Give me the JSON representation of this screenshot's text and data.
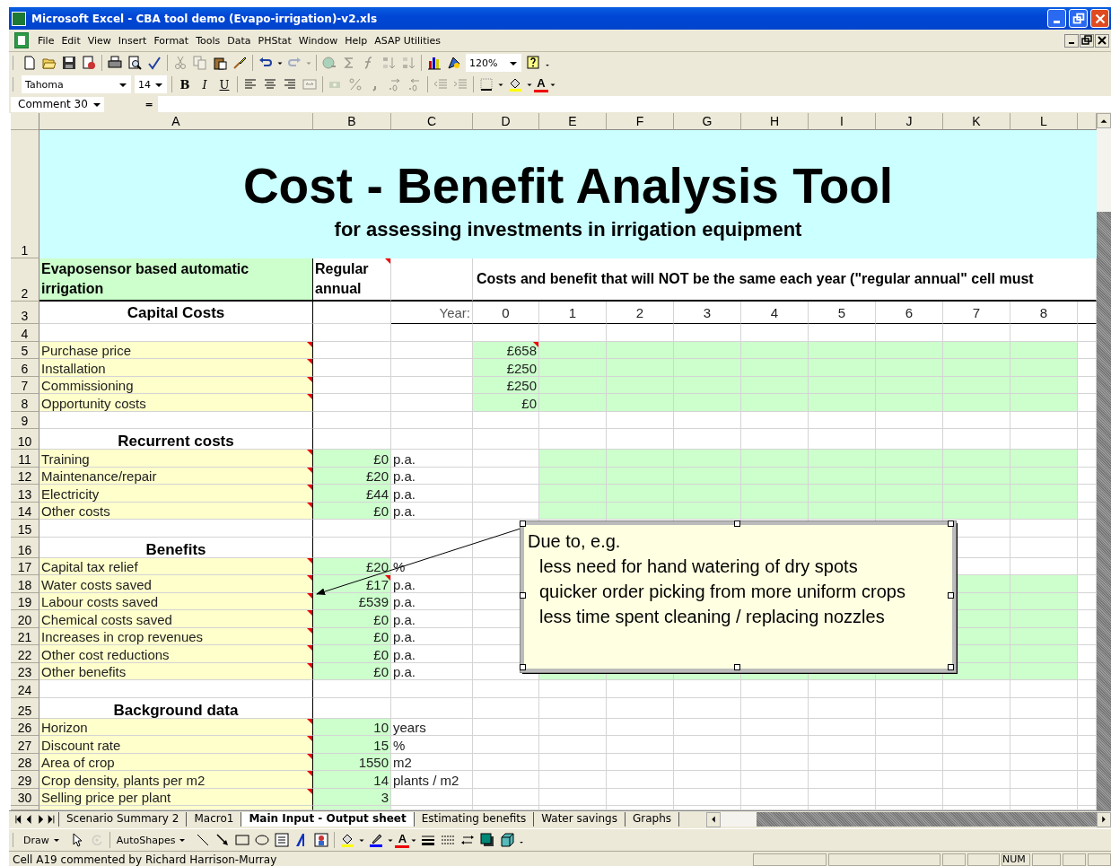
{
  "window": {
    "title": "Microsoft Excel - CBA tool demo (Evapo-irrigation)-v2.xls"
  },
  "menu": [
    "File",
    "Edit",
    "View",
    "Insert",
    "Format",
    "Tools",
    "Data",
    "PHStat",
    "Window",
    "Help",
    "ASAP Utilities"
  ],
  "standard_toolbar": {
    "buttons": [
      {
        "disabled": false
      },
      {
        "disabled": false
      },
      {
        "disabled": false
      },
      {
        "disabled": false
      },
      {
        "disabled": false
      },
      {
        "disabled": false
      },
      {
        "disabled": false
      },
      {
        "disabled": true
      },
      {
        "disabled": true
      },
      {
        "disabled": false
      },
      {
        "disabled": false
      },
      {
        "disabled": false
      },
      {
        "disabled": false
      },
      {
        "disabled": true
      },
      {
        "disabled": true
      },
      {
        "disabled": true
      },
      {
        "disabled": true
      },
      {
        "disabled": true
      },
      {
        "disabled": true
      },
      {
        "disabled": true
      },
      {
        "disabled": false
      },
      {
        "disabled": false
      }
    ],
    "zoom": "120%"
  },
  "formatting_toolbar": {
    "font": "Tahoma",
    "size": "14",
    "bold": "B",
    "italic": "I",
    "underline": "U",
    "font_color_label": "A",
    "buttons": [
      {
        "disabled": false
      },
      {
        "disabled": false
      },
      {
        "disabled": false
      },
      {
        "disabled": true
      },
      {
        "disabled": true
      },
      {
        "disabled": true
      },
      {
        "disabled": true
      },
      {
        "disabled": true
      },
      {
        "disabled": true
      },
      {
        "disabled": true
      },
      {
        "disabled": true
      },
      {
        "disabled": false
      },
      {
        "disabled": false
      }
    ]
  },
  "formula_bar": {
    "name_box": "Comment 30",
    "equals": "="
  },
  "columns": [
    "A",
    "B",
    "C",
    "D",
    "E",
    "F",
    "G",
    "H",
    "I",
    "J",
    "K",
    "L"
  ],
  "title": "Cost - Benefit Analysis Tool",
  "subtitle": "for assessing investments in irrigation equipment",
  "rows": [
    {
      "n": "1",
      "kind": "title"
    },
    {
      "n": "2",
      "kind": "header",
      "a": "Evaposensor based automatic irrigation",
      "b": "Regular annual",
      "b_note": true,
      "d": "Costs and benefit that will NOT be the same each year (\"regular annual\" cell must"
    },
    {
      "n": "3",
      "kind": "years",
      "a": "Capital Costs",
      "c": "Year:",
      "years": [
        "0",
        "1",
        "2",
        "3",
        "4",
        "5",
        "6",
        "7",
        "8"
      ]
    },
    {
      "n": "4",
      "kind": "blank"
    },
    {
      "n": "5",
      "kind": "capital",
      "a": "Purchase price",
      "a_note": true,
      "d": "£658",
      "d_note": true
    },
    {
      "n": "6",
      "kind": "capital",
      "a": "Installation",
      "a_note": true,
      "d": "£250"
    },
    {
      "n": "7",
      "kind": "capital",
      "a": "Commissioning",
      "a_note": true,
      "d": "£250"
    },
    {
      "n": "8",
      "kind": "capital",
      "a": "Opportunity costs",
      "a_note": true,
      "d": "£0"
    },
    {
      "n": "9",
      "kind": "blank"
    },
    {
      "n": "10",
      "kind": "heading",
      "a": "Recurrent costs"
    },
    {
      "n": "11",
      "kind": "annual",
      "a": "Training",
      "a_note": true,
      "b": "£0",
      "c": "p.a."
    },
    {
      "n": "12",
      "kind": "annual",
      "a": "Maintenance/repair",
      "a_note": true,
      "b": "£20",
      "c": "p.a."
    },
    {
      "n": "13",
      "kind": "annual",
      "a": "Electricity",
      "a_note": true,
      "b": "£44",
      "c": "p.a."
    },
    {
      "n": "14",
      "kind": "annual",
      "a": "Other costs",
      "a_note": true,
      "b": "£0",
      "c": "p.a."
    },
    {
      "n": "15",
      "kind": "blank"
    },
    {
      "n": "16",
      "kind": "heading",
      "a": "Benefits"
    },
    {
      "n": "17",
      "kind": "input",
      "a": "Capital tax relief",
      "a_note": true,
      "b": "£20",
      "c": "%"
    },
    {
      "n": "18",
      "kind": "annual",
      "a": "Water costs saved",
      "a_note": true,
      "b": "£17",
      "b_note": true,
      "c": "p.a."
    },
    {
      "n": "19",
      "kind": "annual",
      "a": "Labour costs saved",
      "a_note": true,
      "b": "£539",
      "c": "p.a."
    },
    {
      "n": "20",
      "kind": "annual",
      "a": "Chemical costs saved",
      "a_note": true,
      "b": "£0",
      "c": "p.a."
    },
    {
      "n": "21",
      "kind": "annual",
      "a": "Increases in crop revenues",
      "a_note": true,
      "b": "£0",
      "c": "p.a."
    },
    {
      "n": "22",
      "kind": "annual",
      "a": "Other cost reductions",
      "a_note": true,
      "b": "£0",
      "c": "p.a."
    },
    {
      "n": "23",
      "kind": "annual",
      "a": "Other benefits",
      "a_note": true,
      "b": "£0",
      "c": "p.a."
    },
    {
      "n": "24",
      "kind": "blank"
    },
    {
      "n": "25",
      "kind": "heading",
      "a": "Background data"
    },
    {
      "n": "26",
      "kind": "input",
      "a": "Horizon",
      "a_note": true,
      "b": "10",
      "c": "years"
    },
    {
      "n": "27",
      "kind": "input",
      "a": "Discount rate",
      "a_note": true,
      "b": "15",
      "c": "%"
    },
    {
      "n": "28",
      "kind": "input",
      "a": "Area of crop",
      "a_note": true,
      "b": "1550",
      "c": "m2"
    },
    {
      "n": "29",
      "kind": "input",
      "a": "Crop density, plants per m2",
      "a_note": true,
      "b": "14",
      "c": "plants / m2"
    },
    {
      "n": "30",
      "kind": "input",
      "a": "Selling price per plant",
      "a_note": true,
      "b": "3"
    }
  ],
  "comment": {
    "lines": [
      "Due to, e.g.",
      "less need for hand watering of dry spots",
      "quicker order picking from more uniform crops",
      "less time spent cleaning / replacing nozzles"
    ]
  },
  "sheet_tabs": [
    {
      "label": "Scenario Summary 2",
      "selected": false
    },
    {
      "label": "Macro1",
      "selected": false
    },
    {
      "label": "Main Input - Output sheet",
      "selected": true
    },
    {
      "label": "Estimating benefits",
      "selected": false
    },
    {
      "label": "Water savings",
      "selected": false
    },
    {
      "label": "Graphs",
      "selected": false
    }
  ],
  "drawing_toolbar": {
    "draw": "Draw",
    "autoshapes": "AutoShapes",
    "font_color_label": "A"
  },
  "status_bar": {
    "text": "Cell A19 commented by Richard Harrison-Murray",
    "num": "NUM"
  }
}
